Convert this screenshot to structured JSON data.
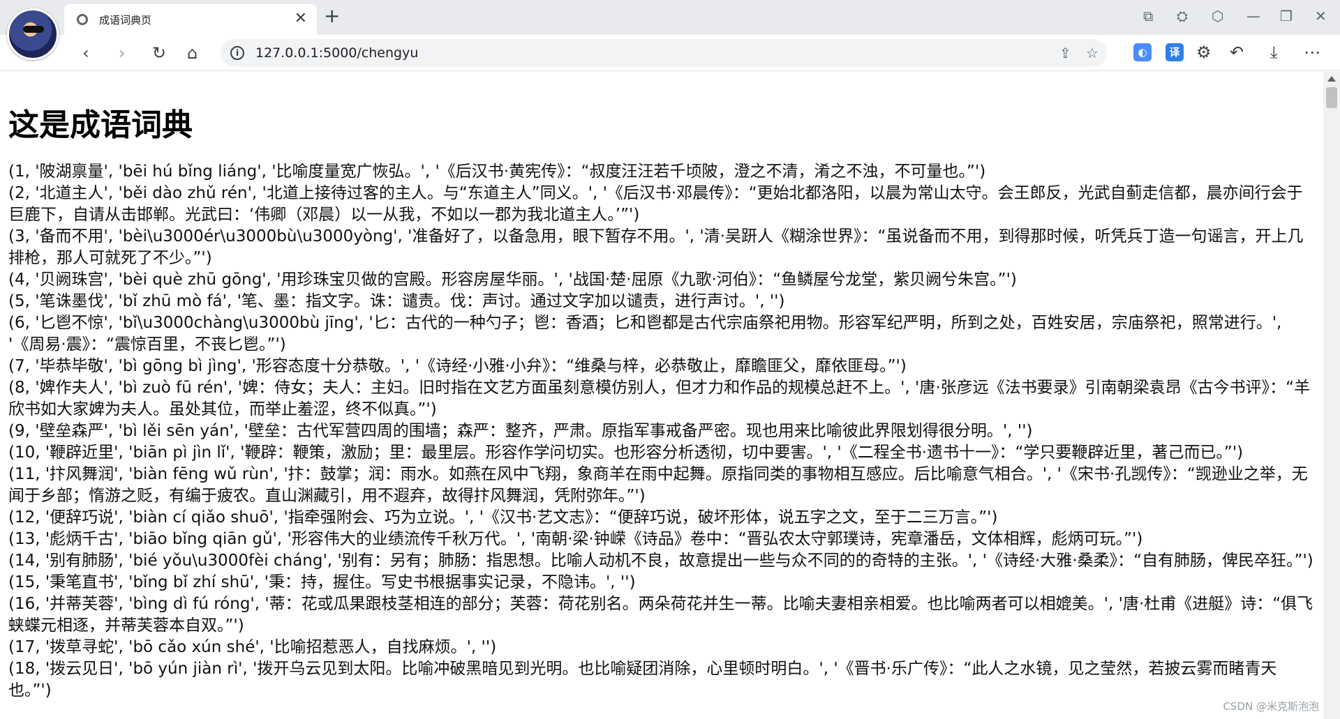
{
  "browser": {
    "tab_title": "成语词典页",
    "url": "127.0.0.1:5000/chengyu",
    "new_tab_icon": "plus-icon",
    "close_tab_icon": "close-icon"
  },
  "page": {
    "title": "这是成语词典",
    "entries": [
      "(1, '陂湖禀量', 'bēi hú bǐng liáng', '比喻度量宽广恢弘。', '《后汉书·黄宪传》：“叔度汪汪若千顷陂，澄之不清，淆之不浊，不可量也。”')",
      "(2, '北道主人', 'běi dào zhǔ rén', '北道上接待过客的主人。与“东道主人”同义。', '《后汉书·邓晨传》：“更始北都洛阳，以晨为常山太守。会王郎反，光武自蓟走信都，晨亦间行会于巨鹿下，自请从击邯郸。光武曰：‘伟卿（邓晨）以一从我，不如以一郡为我北道主人。’”')",
      "(3, '备而不用', 'bèi\\u3000ér\\u3000bù\\u3000yòng', '准备好了，以备急用，眼下暂存不用。', '清·吴趼人《糊涂世界》：“虽说备而不用，到得那时候，听凭兵丁造一句谣言，开上几排枪，那人可就死了不少。”')",
      "(4, '贝阙珠宫', 'bèi què zhū gōng', '用珍珠宝贝做的宫殿。形容房屋华丽。', '战国·楚·屈原《九歌·河伯》：“鱼鳞屋兮龙堂，紫贝阙兮朱宫。”')",
      "(5, '笔诛墨伐', 'bǐ zhū mò fá', '笔、墨：指文字。诛：谴责。伐：声讨。通过文字加以谴责，进行声讨。', '')",
      "(6, '匕鬯不惊', 'bǐ\\u3000chàng\\u3000bù jīng', '匕：古代的一种勺子；鬯：香酒；匕和鬯都是古代宗庙祭祀用物。形容军纪严明，所到之处，百姓安居，宗庙祭祀，照常进行。', '《周易·震》：“震惊百里，不丧匕鬯。”')",
      "(7, '毕恭毕敬', 'bì gōng bì jìng', '形容态度十分恭敬。', '《诗经·小雅·小弁》：“维桑与梓，必恭敬止，靡瞻匪父，靡依匪母。”')",
      "(8, '婢作夫人', 'bì zuò fū rén', '婢：侍女；夫人：主妇。旧时指在文艺方面虽刻意模仿别人，但才力和作品的规模总赶不上。', '唐·张彦远《法书要录》引南朝梁袁昂《古今书评》：“羊欣书如大家婢为夫人。虽处其位，而举止羞涩，终不似真。”')",
      "(9, '壁垒森严', 'bì lěi sēn yán', '壁垒：古代军营四周的围墙；森严：整齐，严肃。原指军事戒备严密。现也用来比喻彼此界限划得很分明。', '')",
      "(10, '鞭辟近里', 'biān pì jìn lǐ', '鞭辟：鞭策，激励；里：最里层。形容作学问切实。也形容分析透彻，切中要害。', '《二程全书·遗书十一》：“学只要鞭辟近里，著己而已。”')",
      "(11, '抃风舞润', 'biàn fēng wǔ rùn', '抃：鼓掌；润：雨水。如燕在风中飞翔，象商羊在雨中起舞。原指同类的事物相互感应。后比喻意气相合。', '《宋书·孔觊传》：“觊逊业之举，无闻于乡部；惰游之贬，有编于疲农。直山渊藏引，用不遐弃，故得抃风舞润，凭附弥年。”')",
      "(12, '便辞巧说', 'biàn cí qiǎo shuō', '指牵强附会、巧为立说。', '《汉书·艺文志》：“便辞巧说，破坏形体，说五字之文，至于二三万言。”')",
      "(13, '彪炳千古', 'biāo bǐng qiān gǔ', '形容伟大的业绩流传千秋万代。', '南朝·梁·钟嵘《诗品》卷中：“晋弘农太守郭璞诗，宪章潘岳，文体相辉，彪炳可玩。”')",
      "(14, '别有肺肠', 'bié yǒu\\u3000fèi cháng', '别有：另有；肺肠：指思想。比喻人动机不良，故意提出一些与众不同的的奇特的主张。', '《诗经·大雅·桑柔》：“自有肺肠，俾民卒狂。”')",
      "(15, '秉笔直书', 'bǐng bǐ zhí shū', '秉：持，握住。写史书根据事实记录，不隐讳。', '')",
      "(16, '并蒂芙蓉', 'bìng dì fú róng', '蒂：花或瓜果跟枝茎相连的部分；芙蓉：荷花别名。两朵荷花并生一蒂。比喻夫妻相亲相爱。也比喻两者可以相媲美。', '唐·杜甫《进艇》诗：“俱飞蛱蝶元相逐，并蒂芙蓉本自双。”')",
      "(17, '拨草寻蛇', 'bō cǎo xún shé', '比喻招惹恶人，自找麻烦。', '')",
      "(18, '拨云见日', 'bō yún jiàn rì', '拨开乌云见到太阳。比喻冲破黑暗见到光明。也比喻疑团消除，心里顿时明白。', '《晋书·乐广传》：“此人之水镜，见之莹然，若披云雾而睹青天也。”')"
    ]
  },
  "watermark": "CSDN @米克斯泡泡"
}
